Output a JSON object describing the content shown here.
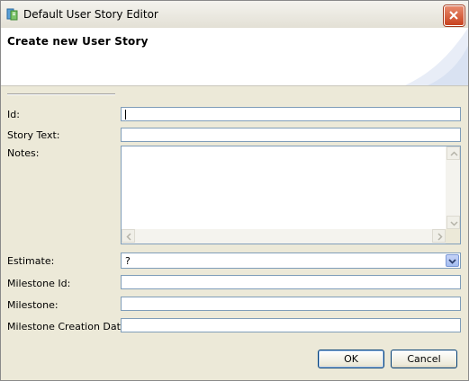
{
  "window": {
    "title": "Default User Story Editor"
  },
  "banner": {
    "title": "Create new User Story"
  },
  "fields": {
    "id": {
      "label": "Id:",
      "value": ""
    },
    "story_text": {
      "label": "Story Text:",
      "value": ""
    },
    "notes": {
      "label": "Notes:",
      "value": ""
    },
    "estimate": {
      "label": "Estimate:",
      "value": "?"
    },
    "milestone_id": {
      "label": "Milestone Id:",
      "value": ""
    },
    "milestone": {
      "label": "Milestone:",
      "value": ""
    },
    "milestone_creation_date": {
      "label": "Milestone Creation Date:",
      "value": ""
    }
  },
  "buttons": {
    "ok": "OK",
    "cancel": "Cancel"
  },
  "icons": {
    "app": "app-icon",
    "close": "close-icon"
  },
  "colors": {
    "close_button": "#c8421e",
    "input_border": "#7f9db9",
    "dialog_bg": "#ece9d8"
  }
}
